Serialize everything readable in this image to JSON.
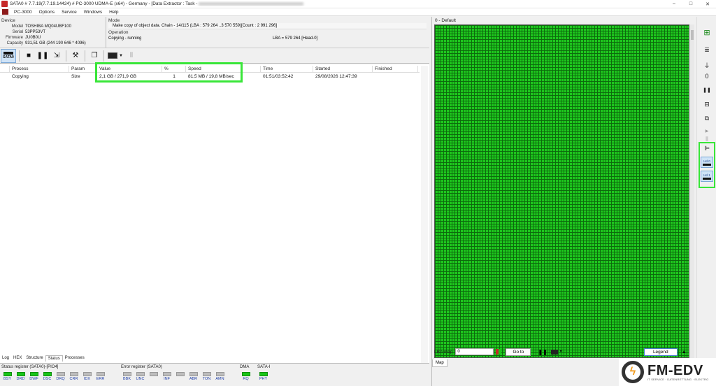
{
  "window": {
    "title": "SATA0 # 7.7.19(7.7.19.14424) # PC-3000 UDMA-E (x64) - Germany - [Data Extractor : Task -",
    "controls": [
      "–",
      "□",
      "✕"
    ]
  },
  "menu": [
    "PC-3000",
    "Options",
    "Service",
    "Windows",
    "Help"
  ],
  "device": {
    "header": "Device",
    "rows": [
      {
        "k": "Model",
        "v": "TOSHIBA MQ04UBF100"
      },
      {
        "k": "Serial",
        "v": "53PP53VT"
      },
      {
        "k": "Firmware",
        "v": "JU0B0U"
      },
      {
        "k": "Capacity",
        "v": "931,51 GB (244 190 646 * 4096)"
      }
    ]
  },
  "mode": {
    "header": "Mode",
    "description": "Make copy of object data. Chain - 14/115 (LBA : 579 264 ..3 570 559)[Count : 2 991 296]",
    "operation_header": "Operation",
    "status": "Copying - running",
    "lba": "LBA =   579 264  [Head-0]"
  },
  "toolbar": {
    "sata_label": "SATA0"
  },
  "grid": {
    "columns": [
      "",
      "Process",
      "Param",
      "Value",
      "%",
      "Speed",
      "Time",
      "Started",
      "Finished"
    ],
    "rows": [
      {
        "c0": "",
        "process": "Copying",
        "param": "Size",
        "value": "2,1 GB / 271,9 GB",
        "pct": "1",
        "speed": "81,5 MB / 19,8 MB/sec",
        "time": "01:51/03:52:42",
        "started": "29/08/2026 12:47:39",
        "finished": ""
      }
    ]
  },
  "bottom_tabs": [
    "Log",
    "HEX",
    "Structure",
    "Status",
    "Processes"
  ],
  "registers": {
    "status": {
      "title": "Status register (SATA0)-[PIO4]",
      "leds": [
        {
          "l": "BSY",
          "on": true
        },
        {
          "l": "DRD",
          "on": true
        },
        {
          "l": "DWF",
          "on": true
        },
        {
          "l": "DSC",
          "on": true
        },
        {
          "l": "DRQ",
          "on": false
        },
        {
          "l": "CRR",
          "on": false
        },
        {
          "l": "IDX",
          "on": false
        },
        {
          "l": "ERR",
          "on": false
        }
      ]
    },
    "error": {
      "title": "Error register (SATA0)",
      "leds": [
        {
          "l": "BBK",
          "on": false
        },
        {
          "l": "UNC",
          "on": false
        },
        {
          "l": "",
          "on": false
        },
        {
          "l": "INF",
          "on": false
        },
        {
          "l": "",
          "on": false
        },
        {
          "l": "ABR",
          "on": false
        },
        {
          "l": "TON",
          "on": false
        },
        {
          "l": "AMN",
          "on": false
        }
      ]
    },
    "dma": {
      "title": "DMA",
      "leds": [
        {
          "l": "RQ",
          "on": true
        }
      ]
    },
    "sata": {
      "title": "SATA-I",
      "leds": [
        {
          "l": "PHY",
          "on": true
        }
      ]
    }
  },
  "map": {
    "title": "0 - Default",
    "lba_label": "LBA map",
    "lba_value": "0",
    "goto_label": "Go to",
    "legend_label": "Legend",
    "tab": "Map",
    "cell_color": "#1ec81e"
  },
  "side_toolbar": {
    "hd0": "Hd 0",
    "hd1": "Hd 1"
  },
  "logo": {
    "brand": "FM-EDV",
    "subtitle": "IT SERVICE · DATENRETTUNG · ELEKTRO"
  }
}
